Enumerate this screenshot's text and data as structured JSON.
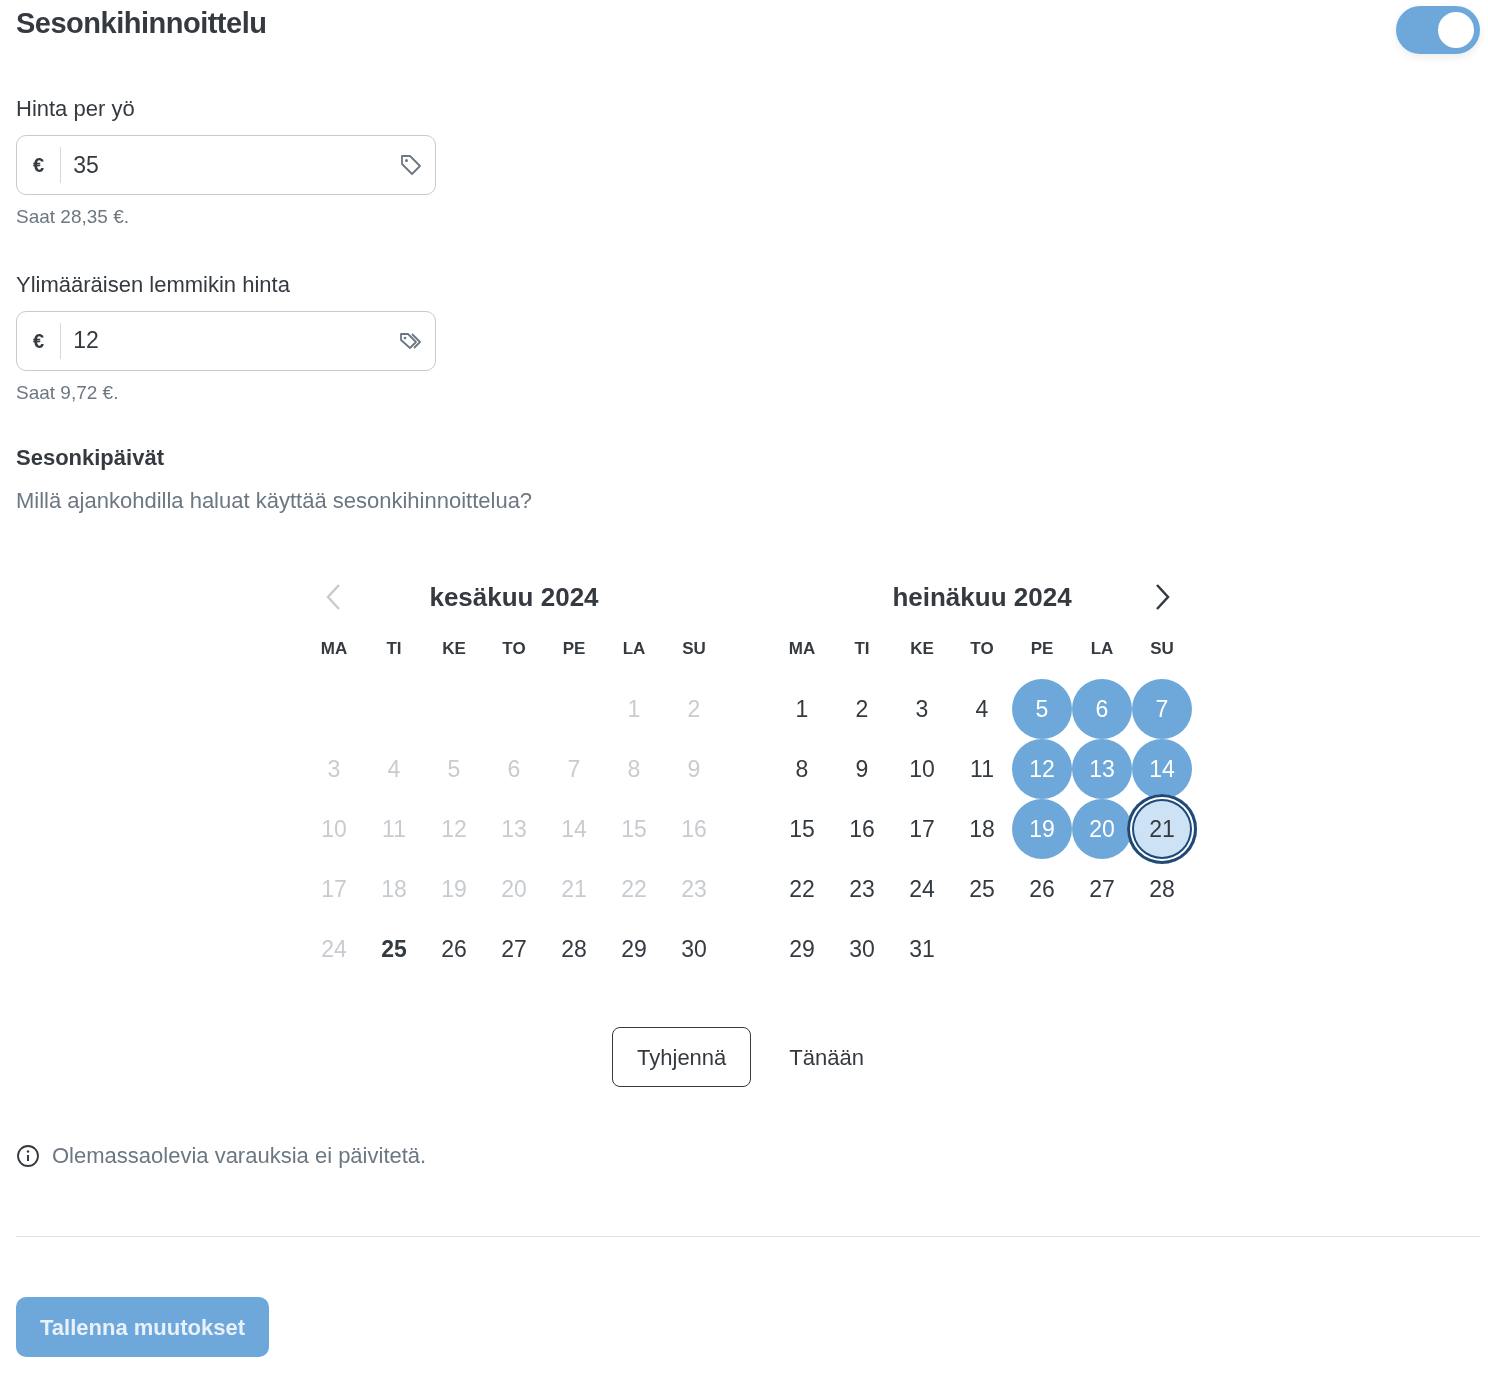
{
  "title": "Sesonkihinnoittelu",
  "toggle": {
    "on": true
  },
  "fields": [
    {
      "label": "Hinta per yö",
      "currency": "€",
      "value": "35",
      "hint": "Saat 28,35 €."
    },
    {
      "label": "Ylimääräisen lemmikin hinta",
      "currency": "€",
      "value": "12",
      "hint": "Saat 9,72 €."
    }
  ],
  "season": {
    "heading": "Sesonkipäivät",
    "question": "Millä ajankohdilla haluat käyttää sesonkihinnoittelua?"
  },
  "calendar": {
    "prev_disabled": true,
    "months": [
      {
        "title": "kesäkuu 2024",
        "weekdays": [
          "MA",
          "TI",
          "KE",
          "TO",
          "PE",
          "LA",
          "SU"
        ],
        "weeks": [
          [
            {
              "d": "1",
              "kind": "past"
            },
            {
              "d": "2",
              "kind": "past"
            }
          ],
          [
            {
              "d": "3",
              "kind": "past"
            },
            {
              "d": "4",
              "kind": "past"
            },
            {
              "d": "5",
              "kind": "past"
            },
            {
              "d": "6",
              "kind": "past"
            },
            {
              "d": "7",
              "kind": "past"
            },
            {
              "d": "8",
              "kind": "past"
            },
            {
              "d": "9",
              "kind": "past"
            }
          ],
          [
            {
              "d": "10",
              "kind": "past"
            },
            {
              "d": "11",
              "kind": "past"
            },
            {
              "d": "12",
              "kind": "past"
            },
            {
              "d": "13",
              "kind": "past"
            },
            {
              "d": "14",
              "kind": "past"
            },
            {
              "d": "15",
              "kind": "past"
            },
            {
              "d": "16",
              "kind": "past"
            }
          ],
          [
            {
              "d": "17",
              "kind": "past"
            },
            {
              "d": "18",
              "kind": "past"
            },
            {
              "d": "19",
              "kind": "past"
            },
            {
              "d": "20",
              "kind": "past"
            },
            {
              "d": "21",
              "kind": "past"
            },
            {
              "d": "22",
              "kind": "past"
            },
            {
              "d": "23",
              "kind": "past"
            }
          ],
          [
            {
              "d": "24",
              "kind": "past"
            },
            {
              "d": "25",
              "kind": "today"
            },
            {
              "d": "26",
              "kind": "free"
            },
            {
              "d": "27",
              "kind": "free"
            },
            {
              "d": "28",
              "kind": "free"
            },
            {
              "d": "29",
              "kind": "free"
            },
            {
              "d": "30",
              "kind": "free"
            }
          ]
        ]
      },
      {
        "title": "heinäkuu 2024",
        "weekdays": [
          "MA",
          "TI",
          "KE",
          "TO",
          "PE",
          "LA",
          "SU"
        ],
        "weeks": [
          [
            {
              "d": "1",
              "kind": "free"
            },
            {
              "d": "2",
              "kind": "free"
            },
            {
              "d": "3",
              "kind": "free"
            },
            {
              "d": "4",
              "kind": "free"
            },
            {
              "d": "5",
              "kind": "selected"
            },
            {
              "d": "6",
              "kind": "selected"
            },
            {
              "d": "7",
              "kind": "selected"
            }
          ],
          [
            {
              "d": "8",
              "kind": "free"
            },
            {
              "d": "9",
              "kind": "free"
            },
            {
              "d": "10",
              "kind": "free"
            },
            {
              "d": "11",
              "kind": "free"
            },
            {
              "d": "12",
              "kind": "selected"
            },
            {
              "d": "13",
              "kind": "selected"
            },
            {
              "d": "14",
              "kind": "selected"
            }
          ],
          [
            {
              "d": "15",
              "kind": "free"
            },
            {
              "d": "16",
              "kind": "free"
            },
            {
              "d": "17",
              "kind": "free"
            },
            {
              "d": "18",
              "kind": "free"
            },
            {
              "d": "19",
              "kind": "selected"
            },
            {
              "d": "20",
              "kind": "selected"
            },
            {
              "d": "21",
              "kind": "focused"
            }
          ],
          [
            {
              "d": "22",
              "kind": "free"
            },
            {
              "d": "23",
              "kind": "free"
            },
            {
              "d": "24",
              "kind": "free"
            },
            {
              "d": "25",
              "kind": "free"
            },
            {
              "d": "26",
              "kind": "free"
            },
            {
              "d": "27",
              "kind": "free"
            },
            {
              "d": "28",
              "kind": "free"
            }
          ],
          [
            {
              "d": "29",
              "kind": "free"
            },
            {
              "d": "30",
              "kind": "free"
            },
            {
              "d": "31",
              "kind": "free"
            }
          ]
        ]
      }
    ],
    "clear": "Tyhjennä",
    "today": "Tänään"
  },
  "note": "Olemassaolevia varauksia ei päivitetä.",
  "save": {
    "label": "Tallenna muutokset",
    "disabled": true
  }
}
